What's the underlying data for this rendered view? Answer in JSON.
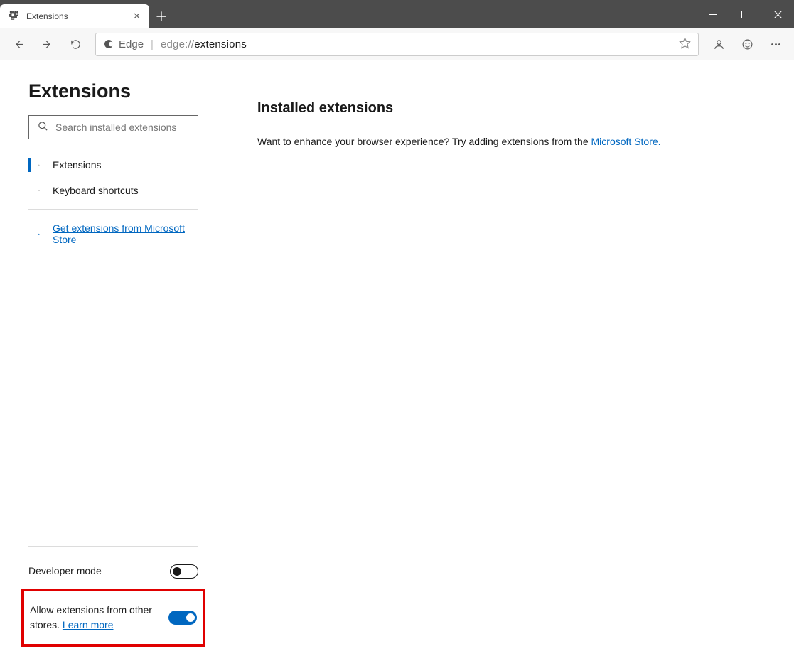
{
  "tab": {
    "title": "Extensions"
  },
  "address": {
    "brand": "Edge",
    "url_prefix": "edge://",
    "url_suffix": "extensions"
  },
  "sidebar": {
    "title": "Extensions",
    "search_placeholder": "Search installed extensions",
    "nav": {
      "extensions": "Extensions",
      "shortcuts": "Keyboard shortcuts"
    },
    "store_link": "Get extensions from Microsoft Store",
    "dev_mode": {
      "label": "Developer mode",
      "on": false
    },
    "allow_other": {
      "label_before": "Allow extensions from other stores. ",
      "learn_more": "Learn more",
      "on": true
    }
  },
  "main": {
    "heading": "Installed extensions",
    "text_before": "Want to enhance your browser experience? Try adding extensions from the ",
    "link": "Microsoft Store."
  }
}
